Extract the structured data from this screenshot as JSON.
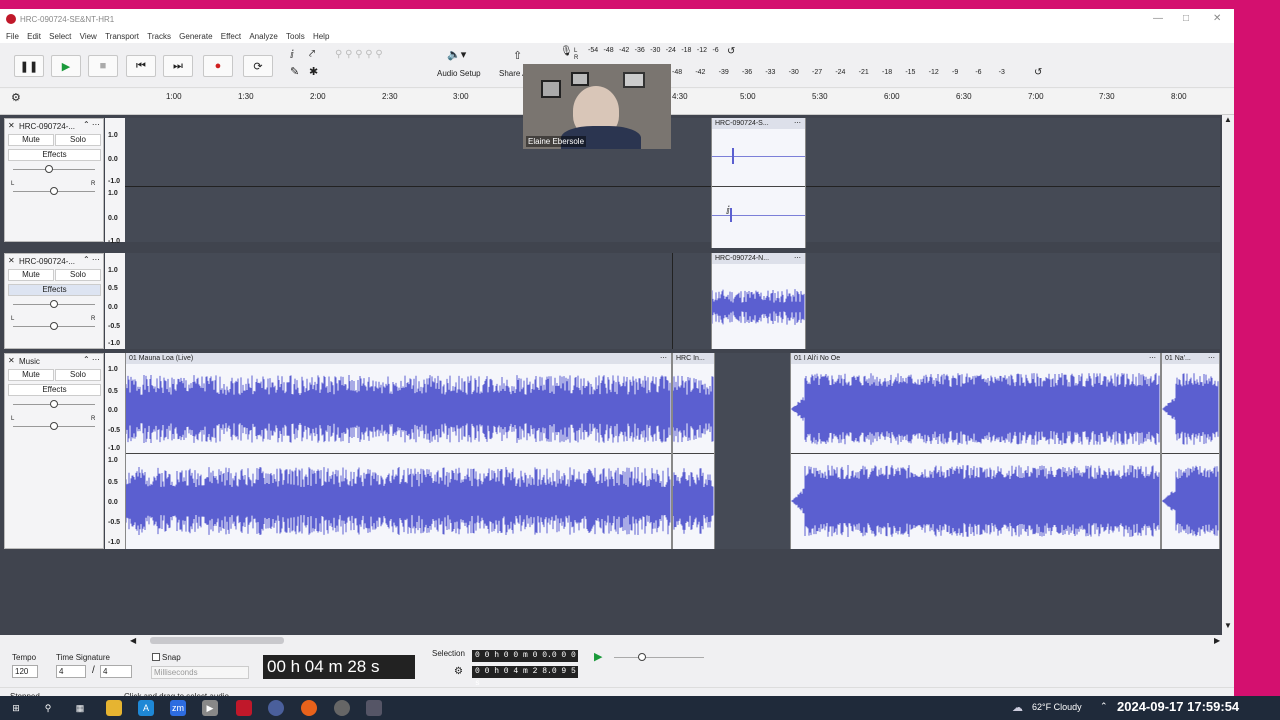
{
  "window": {
    "title": "HRC-090724-SE&NT-HR1"
  },
  "menu": [
    "File",
    "Edit",
    "Select",
    "View",
    "Transport",
    "Tracks",
    "Generate",
    "Effect",
    "Analyze",
    "Tools",
    "Help"
  ],
  "toolbar": {
    "audio_setup": "Audio Setup",
    "share": "Share A",
    "meter_ticks_top": [
      "-54",
      "-48",
      "-42",
      "-36",
      "-30",
      "-24",
      "-18",
      "-12",
      "-6"
    ],
    "meter_ticks_bottom": [
      "-48",
      "-42",
      "-39",
      "-36",
      "-33",
      "-30",
      "-27",
      "-24",
      "-21",
      "-18",
      "-15",
      "-12",
      "-9",
      "-6",
      "-3"
    ],
    "meter_lr": "L R"
  },
  "ruler": {
    "ticks": [
      "1:00",
      "1:30",
      "2:00",
      "2:30",
      "3:00",
      "4:30",
      "5:00",
      "5:30",
      "6:00",
      "6:30",
      "7:00",
      "7:30",
      "8:00"
    ]
  },
  "tracks": [
    {
      "name": "HRC-090724-...",
      "mute": "Mute",
      "solo": "Solo",
      "effects": "Effects",
      "pan_l": "L",
      "pan_r": "R",
      "scale_top": [
        "1.0",
        "0.0",
        "-1.0"
      ],
      "scale_bottom": [
        "1.0",
        "0.0",
        "-1.0"
      ],
      "clip": "HRC-090724-S..."
    },
    {
      "name": "HRC-090724-...",
      "mute": "Mute",
      "solo": "Solo",
      "effects": "Effects",
      "pan_l": "L",
      "pan_r": "R",
      "scale": [
        "1.0",
        "0.5",
        "0.0",
        "-0.5",
        "-1.0"
      ],
      "clip": "HRC-090724-N..."
    },
    {
      "name": "Music",
      "mute": "Mute",
      "solo": "Solo",
      "effects": "Effects",
      "pan_l": "L",
      "pan_r": "R",
      "scale_top": [
        "1.0",
        "0.5",
        "0.0",
        "-0.5",
        "-1.0"
      ],
      "scale_bottom": [
        "1.0",
        "0.5",
        "0.0",
        "-0.5",
        "-1.0"
      ],
      "clips": [
        "01 Mauna Loa (Live)",
        "HRC In...",
        "01 I Ali'i No Oe",
        "01 Na'..."
      ]
    }
  ],
  "webcam": {
    "name": "Elaine Ebersole"
  },
  "bottom": {
    "tempo_label": "Tempo",
    "tempo_value": "120",
    "timesig_label": "Time Signature",
    "timesig_num": "4",
    "timesig_den": "4",
    "snap_label": "Snap",
    "snap_unit": "Milliseconds",
    "time_display": "00 h 04 m 28 s",
    "selection_label": "Selection",
    "selection_start": "0 0 h 0 0 m 0 0.0 0 0 s",
    "selection_end": "0 0 h 0 4 m 2 8.0 9 5 s"
  },
  "status": {
    "left": "Stopped.",
    "hint": "Click and drag to select audio"
  },
  "taskbar": {
    "weather": "62°F  Cloudy",
    "datetime": "2024-09-17  17:59:54"
  }
}
